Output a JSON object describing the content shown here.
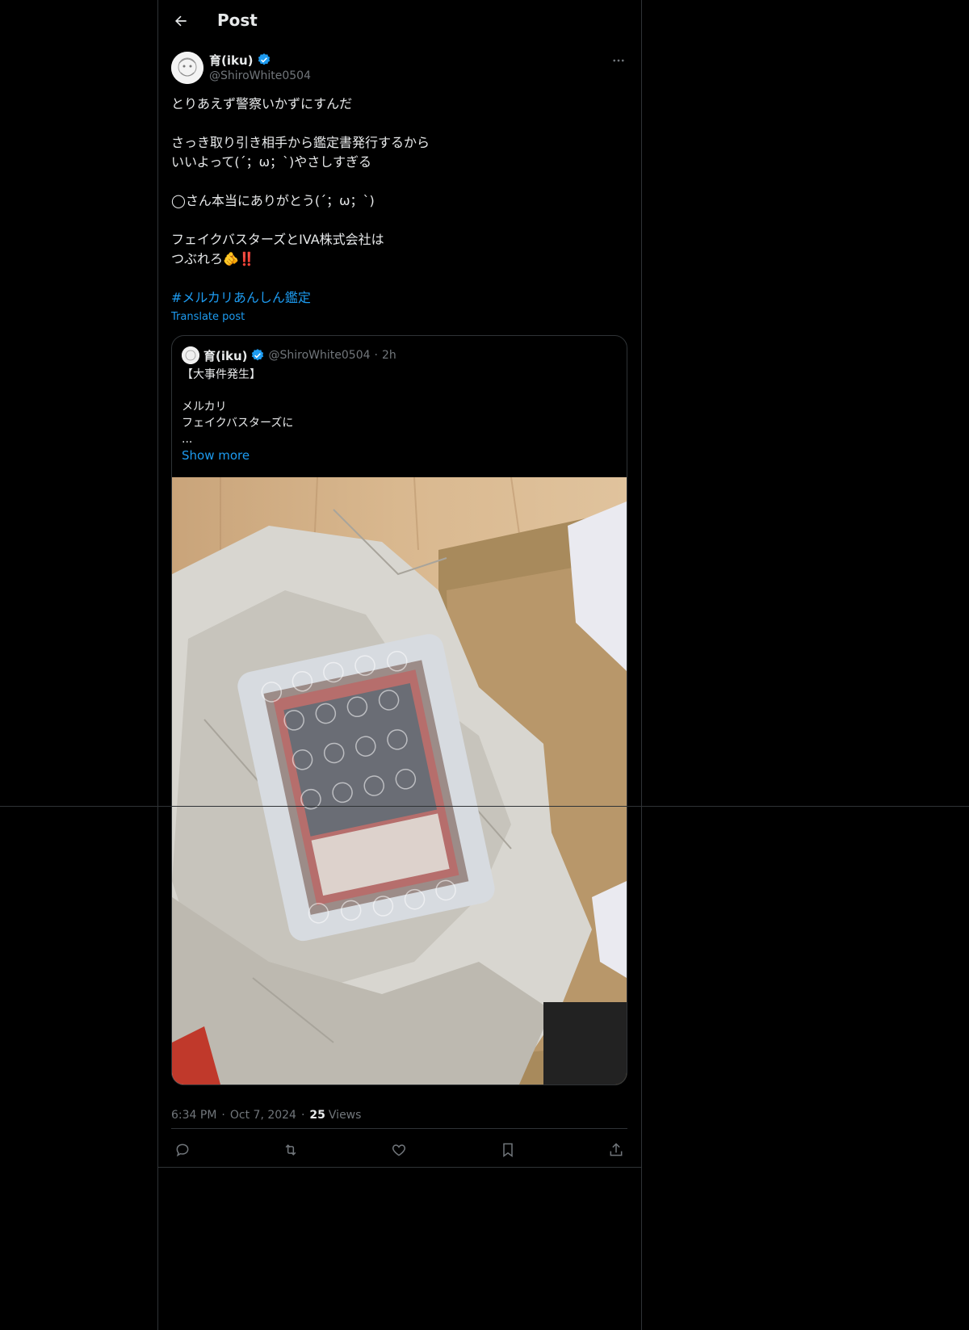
{
  "header": {
    "title": "Post"
  },
  "post": {
    "author_name": "育(iku)",
    "author_handle": "@ShiroWhite0504",
    "lines": [
      "とりあえず警察いかずにすんだ",
      "",
      "さっき取り引き相手から鑑定書発行するから",
      "いいよって(´；ω；`)やさしすぎる",
      "",
      "◯さん本当にありがとう(´；ω；`)",
      "",
      "フェイクバスターズとIVA株式会社は",
      "つぶれろ🫵‼️",
      ""
    ],
    "hashtag": "#メルカリあんしん鑑定",
    "translate": "Translate post",
    "time": "6:34 PM",
    "date": "Oct 7, 2024",
    "views_count": "25",
    "views_label": "Views"
  },
  "quote": {
    "author_name": "育(iku)",
    "author_handle": "@ShiroWhite0504",
    "separator": "·",
    "time": "2h",
    "lines": [
      "【大事件発生】",
      "",
      "メルカリ",
      "フェイクバスターズに",
      "..."
    ],
    "show_more": "Show more"
  },
  "icons": {
    "back": "arrow-left-icon",
    "more": "more-icon",
    "verified": "verified-badge-icon",
    "reply": "reply-icon",
    "repost": "repost-icon",
    "like": "heart-icon",
    "bookmark": "bookmark-icon",
    "share": "share-icon"
  },
  "colors": {
    "accent": "#1d9bf0",
    "muted": "#71767b",
    "text": "#e7e9ea",
    "border": "#2f3336"
  }
}
